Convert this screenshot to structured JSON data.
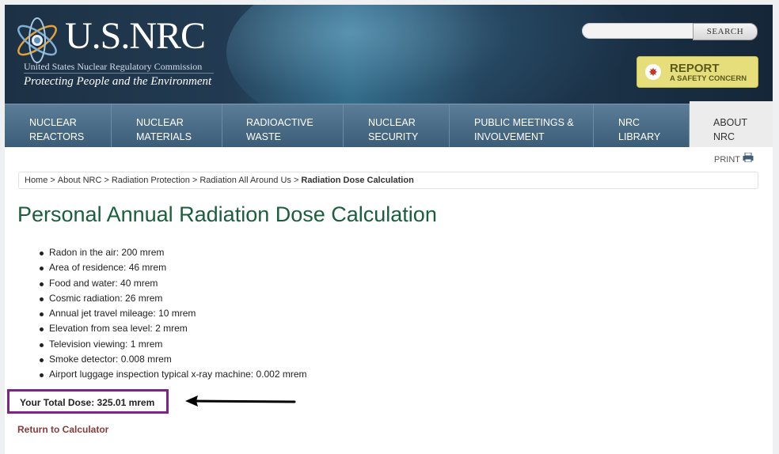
{
  "header": {
    "logo": "U.S.NRC",
    "agency": "United States Nuclear Regulatory Commission",
    "tagline": "Protecting People and the Environment",
    "search_placeholder": "",
    "search_label": "SEARCH",
    "report_main": "REPORT",
    "report_sub": "A SAFETY CONCERN"
  },
  "nav": {
    "items": [
      {
        "label": "NUCLEAR\nREACTORS"
      },
      {
        "label": "NUCLEAR\nMATERIALS"
      },
      {
        "label": "RADIOACTIVE\nWASTE"
      },
      {
        "label": "NUCLEAR\nSECURITY"
      },
      {
        "label": "PUBLIC MEETINGS &\nINVOLVEMENT"
      },
      {
        "label": "NRC\nLIBRARY"
      },
      {
        "label": "ABOUT\nNRC"
      }
    ],
    "active_index": 6
  },
  "print_label": "PRINT",
  "breadcrumb": {
    "items": [
      "Home",
      "About NRC",
      "Radiation Protection",
      "Radiation All Around Us"
    ],
    "current": "Radiation Dose Calculation",
    "separator": ">"
  },
  "page_title": "Personal Annual Radiation Dose Calculation",
  "dose_items": [
    "Radon in the air: 200 mrem",
    "Area of residence: 46 mrem",
    "Food and water: 40 mrem",
    "Cosmic radiation: 26 mrem",
    "Annual jet travel mileage: 10 mrem",
    "Elevation from sea level: 2 mrem",
    "Television viewing: 1 mrem",
    "Smoke detector: 0.008 mrem",
    "Airport luggage inspection typical x-ray machine: 0.002 mrem"
  ],
  "total_dose": "Your Total Dose: 325.01 mrem",
  "return_link": "Return to Calculator",
  "colors": {
    "title_green": "#1b5e3b",
    "highlight_purple": "#7d2585",
    "link_red": "#8b3a3a",
    "report_yellow": "#e5de7a"
  }
}
